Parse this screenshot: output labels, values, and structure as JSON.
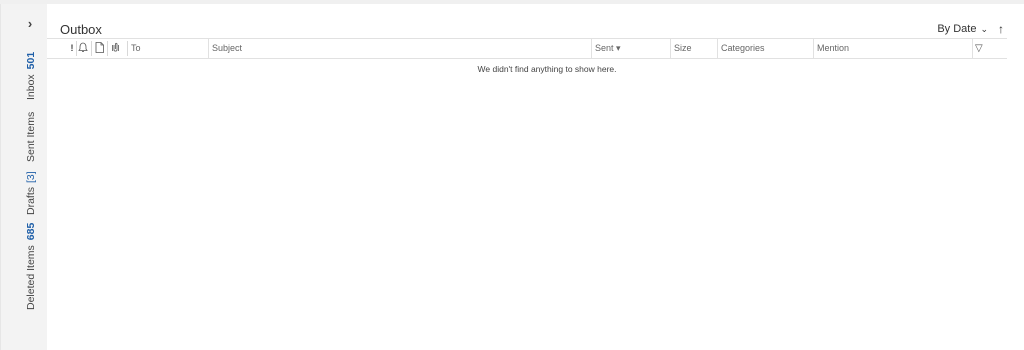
{
  "folder_pane": {
    "expand_glyph": "›",
    "folders": [
      {
        "label": "Inbox",
        "count": "501"
      },
      {
        "label": "Sent Items",
        "count": ""
      },
      {
        "label": "Drafts",
        "count": "[3]"
      },
      {
        "label": "Deleted Items",
        "count": "685"
      }
    ]
  },
  "list": {
    "title": "Outbox",
    "sort_label": "By Date",
    "sort_chevron_glyph": "⌄",
    "sort_direction_glyph": "↑",
    "columns": {
      "importance_glyph": "!",
      "reminder_glyph": "🔔",
      "icon_glyph": "🗋",
      "attachment_glyph": "📎",
      "to": "To",
      "subject": "Subject",
      "sent": "Sent",
      "sent_sort_glyph": "▾",
      "size": "Size",
      "categories": "Categories",
      "mention": "Mention",
      "filter_glyph": "▽"
    },
    "empty_message": "We didn't find anything to show here."
  },
  "colors": {
    "accent_count": "#1f5fa8",
    "pane_bg": "#f3f3f3",
    "border": "#e1e1e1"
  }
}
